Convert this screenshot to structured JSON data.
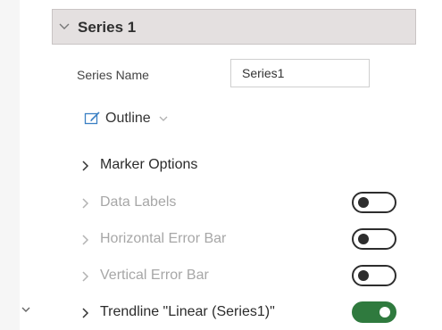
{
  "section": {
    "title": "Series 1"
  },
  "series_name": {
    "label": "Series Name",
    "value": "Series1"
  },
  "outline": {
    "label": "Outline"
  },
  "options": [
    {
      "label": "Marker Options",
      "enabled": true
    },
    {
      "label": "Data Labels",
      "enabled": false,
      "toggle_on": false
    },
    {
      "label": "Horizontal Error Bar",
      "enabled": false,
      "toggle_on": false
    },
    {
      "label": "Vertical Error Bar",
      "enabled": false,
      "toggle_on": false
    },
    {
      "label": "Trendline \"Linear (Series1)\"",
      "enabled": true,
      "toggle_on": true
    }
  ],
  "colors": {
    "toggle_on": "#2f7a3e",
    "header_bg": "#e4e0e0",
    "outline_icon": "#3a7fc4"
  },
  "icons": {
    "section_expand": "chevron-down-icon",
    "outline": "pen-outline-icon",
    "row_expand": "chevron-right-icon",
    "gutter": "chevron-down-icon"
  }
}
